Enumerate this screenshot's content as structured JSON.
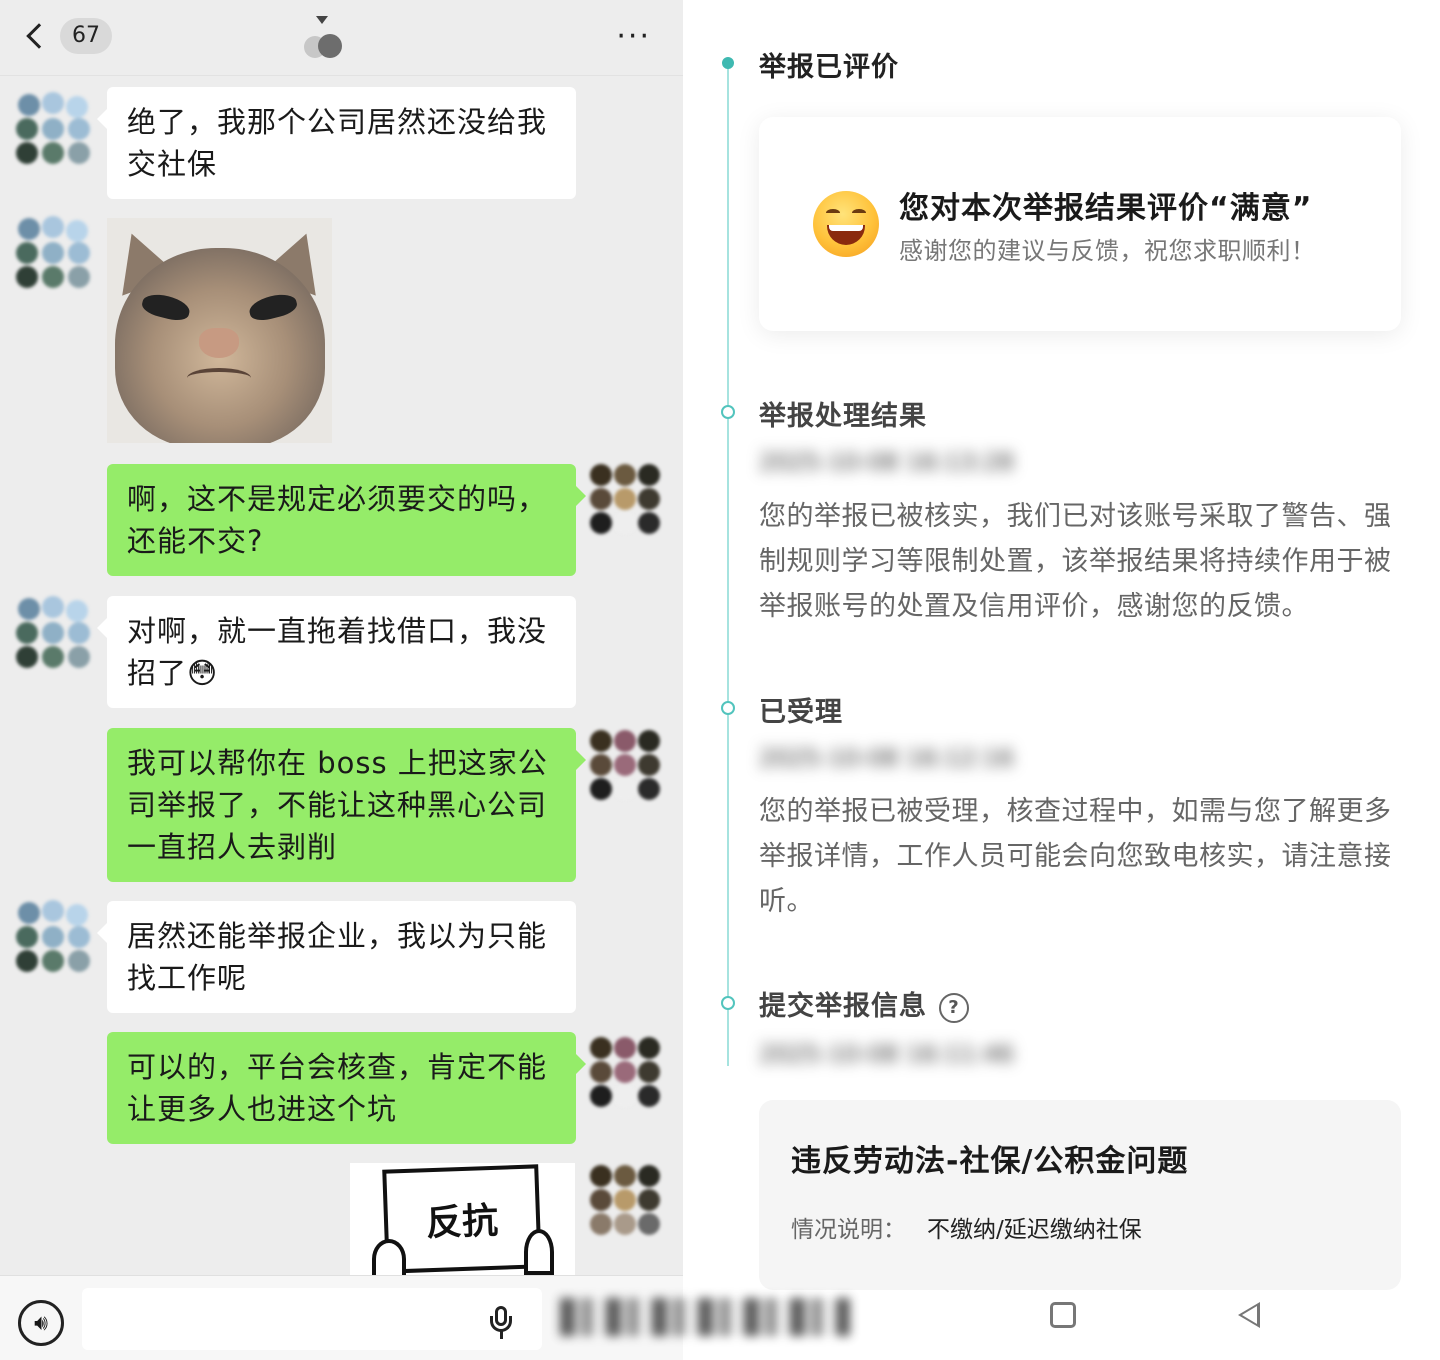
{
  "chat": {
    "unread_count": "67",
    "more_label": "···",
    "messages": [
      {
        "side": "in",
        "text": "绝了，我那个公司居然还没给我交社保"
      },
      {
        "side": "in",
        "type": "sticker",
        "sticker": "angry-cat"
      },
      {
        "side": "out",
        "text": "啊，这不是规定必须要交的吗，还能不交?"
      },
      {
        "side": "in",
        "text": "对啊，就一直拖着找借口，我没招了",
        "emoji": "😳"
      },
      {
        "side": "out",
        "text": "我可以帮你在 boss 上把这家公司举报了，不能让这种黑心公司一直招人去剥削"
      },
      {
        "side": "in",
        "text": "居然还能举报企业，我以为只能找工作呢"
      },
      {
        "side": "out",
        "text": "可以的，平台会核查，肯定不能让更多人也进这个坑"
      },
      {
        "side": "out",
        "type": "sticker",
        "sticker": "fight-sign",
        "sticker_text": "反抗"
      }
    ]
  },
  "report": {
    "steps": [
      {
        "title": "举报已评价"
      },
      {
        "title": "举报处理结果",
        "time": "2025-10-08 16:13:28",
        "desc": "您的举报已被核实，我们已对该账号采取了警告、强制规则学习等限制处置，该举报结果将持续作用于被举报账号的处置及信用评价，感谢您的反馈。"
      },
      {
        "title": "已受理",
        "time": "2025-10-08 16:12:16",
        "desc": "您的举报已被受理，核查过程中，如需与您了解更多举报详情，工作人员可能会向您致电核实，请注意接听。"
      },
      {
        "title": "提交举报信息",
        "time": "2025-10-08 16:11:46"
      }
    ],
    "evaluation": {
      "title": "您对本次举报结果评价“满意”",
      "subtitle": "感谢您的建议与反馈，祝您求职顺利！"
    },
    "info": {
      "title": "违反劳动法-社保/公积金问题",
      "label": "情况说明：",
      "value": "不缴纳/延迟缴纳社保"
    },
    "help_symbol": "?"
  },
  "colors": {
    "chat_bg": "#ededed",
    "bubble_out": "#95ec69",
    "bubble_in": "#ffffff",
    "timeline_accent": "#3fb9b1"
  }
}
